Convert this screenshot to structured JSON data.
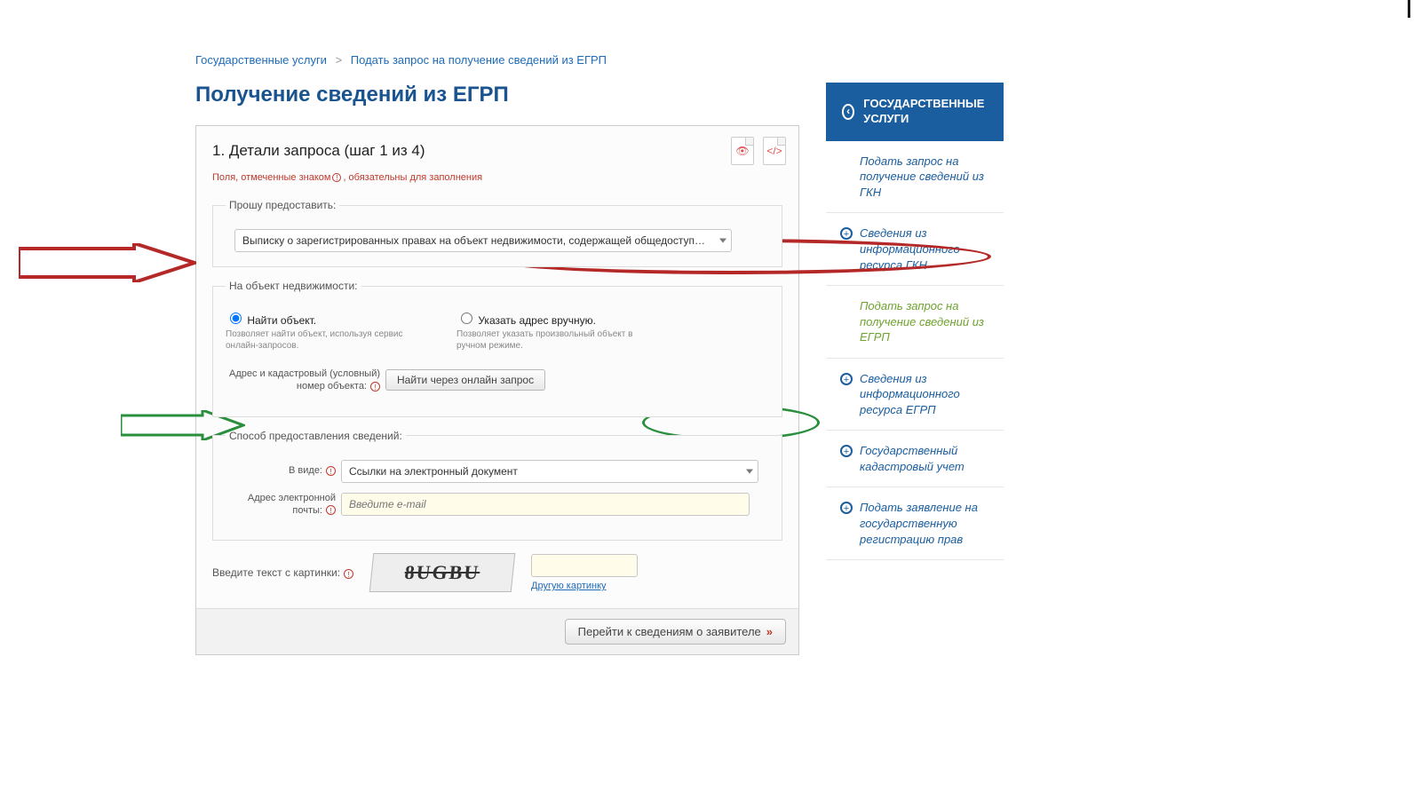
{
  "breadcrumb": {
    "root": "Государственные услуги",
    "current": "Подать запрос на получение сведений из ЕГРП"
  },
  "page_title": "Получение сведений из ЕГРП",
  "step": {
    "title": "1. Детали запроса (шаг 1 из 4)",
    "required_note_prefix": "Поля, отмеченные знаком",
    "required_note_suffix": ", обязательны для заполнения"
  },
  "provide": {
    "legend": "Прошу предоставить:",
    "selected": "Выписку о зарегистрированных правах на объект недвижимости, содержащей общедоступные свед"
  },
  "object": {
    "legend": "На объект недвижимости:",
    "radio_find": "Найти объект.",
    "radio_find_hint": "Позволяет найти объект, используя сервис онлайн-запросов.",
    "radio_manual": "Указать адрес вручную.",
    "radio_manual_hint": "Позволяет указать произвольный объект в ручном режиме.",
    "addr_label": "Адрес и кадастровый (условный) номер объекта:",
    "find_button": "Найти через онлайн запрос"
  },
  "delivery": {
    "legend": "Способ предоставления сведений:",
    "format_label": "В виде:",
    "format_value": "Ссылки на электронный документ",
    "email_label": "Адрес электронной почты:",
    "email_placeholder": "Введите e-mail"
  },
  "captcha": {
    "label": "Введите текст с картинки:",
    "image_text": "8UGBU",
    "refresh": "Другую картинку"
  },
  "submit": "Перейти к сведениям о заявителе",
  "sidebar": {
    "header": "ГОСУДАРСТВЕННЫЕ УСЛУГИ",
    "items": [
      {
        "label": "Подать запрос на получение сведений из ГКН",
        "icon": false,
        "active": false
      },
      {
        "label": "Сведения из информационного ресурса ГКН",
        "icon": true,
        "active": false
      },
      {
        "label": "Подать запрос на получение сведений из ЕГРП",
        "icon": false,
        "active": true
      },
      {
        "label": "Сведения из информационного ресурса ЕГРП",
        "icon": true,
        "active": false
      },
      {
        "label": "Государственный кадастровый учет",
        "icon": true,
        "active": false
      },
      {
        "label": "Подать заявление на государственную регистрацию прав",
        "icon": true,
        "active": false
      }
    ]
  }
}
